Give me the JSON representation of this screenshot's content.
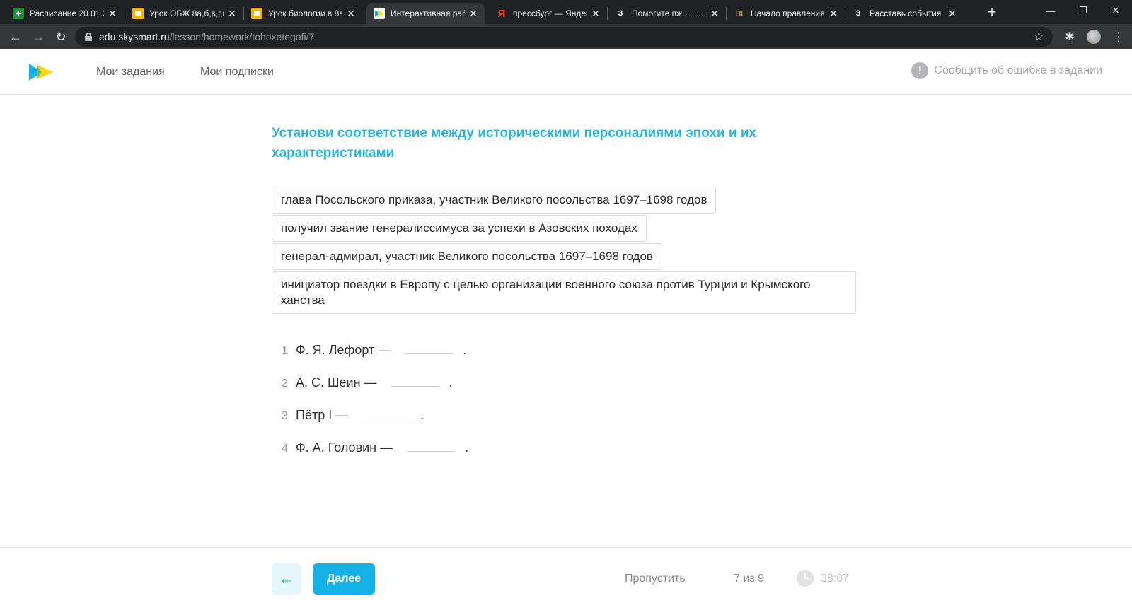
{
  "browser": {
    "tabs": [
      {
        "title": "Расписание 20.01.2",
        "icon": "sheets-icon",
        "icon_color": "#1e8e3e",
        "active": false
      },
      {
        "title": "Урок ОБЖ 8а,б,в,г,к",
        "icon": "slides-icon",
        "icon_color": "#f4b400",
        "active": false
      },
      {
        "title": "Урок биологии в 8а",
        "icon": "slides-icon",
        "icon_color": "#f4b400",
        "active": false
      },
      {
        "title": "Интерактивная раб",
        "icon": "skysmart-icon",
        "icon_color": "#ffffff",
        "active": true
      },
      {
        "title": "прессбург — Яндек",
        "icon": "yandex-icon",
        "icon_color": "#fc3f1d",
        "icon_char": "Я",
        "active": false
      },
      {
        "title": "Помогите пж.........",
        "icon": "znanija-icon",
        "icon_color": "#ffffff",
        "icon_char": "З",
        "active": false
      },
      {
        "title": "Начало правления",
        "icon": "site-icon",
        "icon_color": "#c9a04a",
        "icon_char": "ПI",
        "active": false
      },
      {
        "title": "Расставь события в",
        "icon": "znanija-icon",
        "icon_color": "#ffffff",
        "icon_char": "З",
        "active": false
      }
    ],
    "url_host": "edu.skysmart.ru",
    "url_path": "/lesson/homework/tohoxetegofi/7"
  },
  "header": {
    "nav": [
      "Мои задания",
      "Мои подписки"
    ],
    "report_label": "Сообщить об ошибке в задании"
  },
  "task": {
    "title": "Установи соответствие между историческими персоналиями эпохи и их характеристиками",
    "options": [
      "глава Посольского приказа, участник Великого посольства 1697–1698 годов",
      "получил звание генералиссимуса за успехи в Азовских походах",
      "генерал-адмирал, участник Великого посольства 1697–1698 годов",
      "инициатор поездки в Европу с целью организации военного союза против Турции и Крымского ханства"
    ],
    "questions": [
      {
        "num": "1",
        "text": "Ф. Я. Лефорт —"
      },
      {
        "num": "2",
        "text": "А. С. Шеин —"
      },
      {
        "num": "3",
        "text": "Пётр I —"
      },
      {
        "num": "4",
        "text": "Ф. А. Головин —"
      }
    ],
    "dot": "."
  },
  "footer": {
    "back_icon": "arrow-left-icon",
    "next_label": "Далее",
    "skip_label": "Пропустить",
    "progress": "7 из 9",
    "timer": "38:07"
  },
  "colors": {
    "accent": "#14b1e7",
    "title": "#2ab4e0"
  }
}
